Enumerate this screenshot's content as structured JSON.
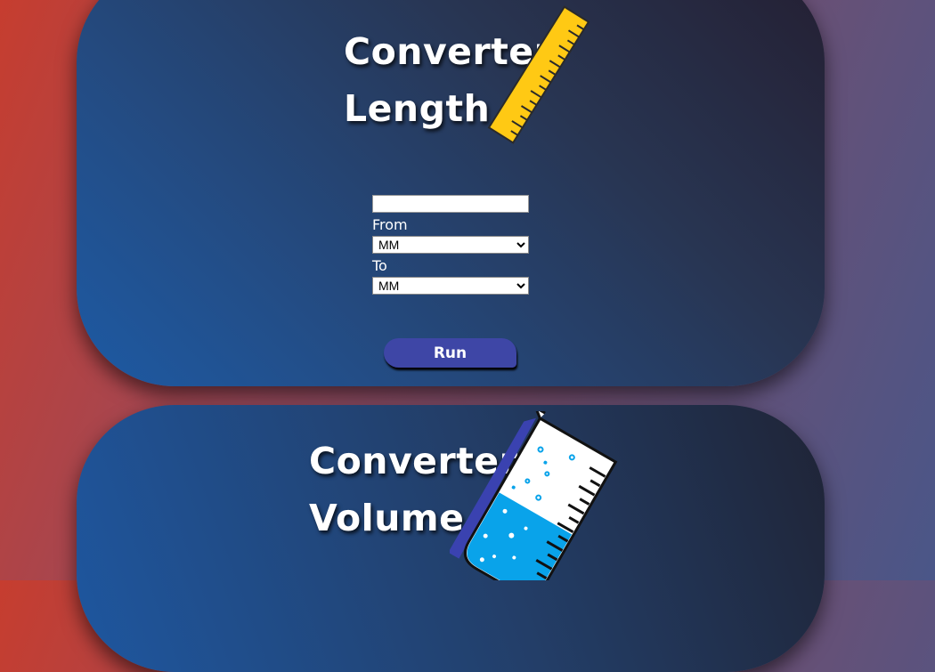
{
  "length_card": {
    "title_line1": "Converter",
    "title_line2": "Length",
    "input_value": "",
    "from_label": "From",
    "from_selected": "MM",
    "to_label": "To",
    "to_selected": "MM",
    "run_label": "Run",
    "icon": "ruler-icon"
  },
  "volume_card": {
    "title_line1": "Converter",
    "title_line2": "Volume",
    "icon": "beaker-icon"
  },
  "colors": {
    "ruler": "#ffc914",
    "button": "#3e46a6",
    "water": "#09a3ea"
  }
}
